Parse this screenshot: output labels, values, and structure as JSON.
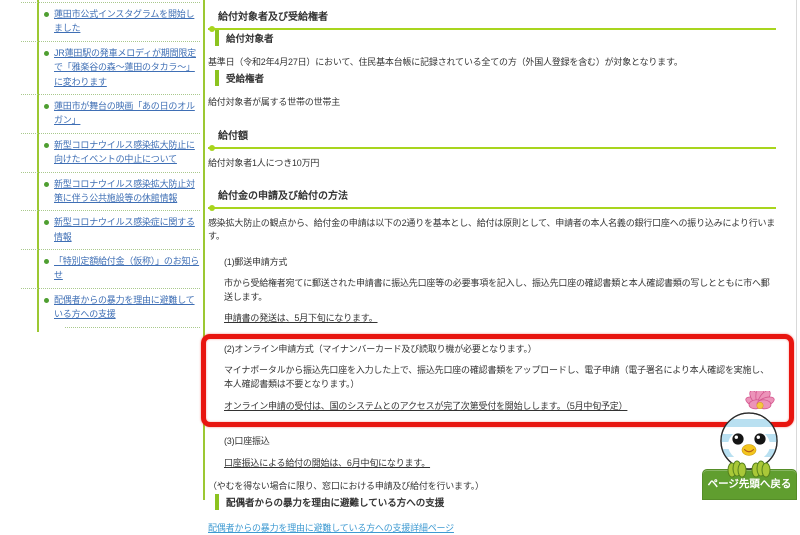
{
  "colors": {
    "accent_green_line": "#a8d51e",
    "accent_green_bar": "#8cc320",
    "sidebar_green_line": "#9cc832",
    "bullet_green": "#4f9f31",
    "link_blue": "#3f6fb5",
    "detail_link_blue": "#3e9ad2",
    "highlight_red": "#e8150f",
    "button_green": "#609e2f",
    "text": "#333333"
  },
  "sidebar": {
    "items": [
      {
        "label": "蓮田市公式インスタグラムを開始しました"
      },
      {
        "label": "JR蓮田駅の発車メロディが期間限定で「雅楽谷の森～蓮田のタカラ～」に変わります"
      },
      {
        "label": "蓮田市が舞台の映画「あの日のオルガン」"
      },
      {
        "label": "新型コロナウイルス感染拡大防止に向けたイベントの中止について"
      },
      {
        "label": "新型コロナウイルス感染拡大防止対策に伴う公共施設等の休館情報"
      },
      {
        "label": "新型コロナウイルス感染症に関する情報"
      },
      {
        "label": "「特別定額給付金（仮称）」のお知らせ"
      },
      {
        "label": "配偶者からの暴力を理由に避難している方への支援"
      }
    ]
  },
  "content": {
    "section1": {
      "h2": "給付対象者及び受給権者",
      "h3a": "給付対象者",
      "p1": "基準日（令和2年4月27日）において、住民基本台帳に記録されている全ての方（外国人登録を含む）が対象となります。",
      "h3b": "受給権者",
      "p2": "給付対象者が属する世帯の世帯主"
    },
    "section2": {
      "h2": "給付額",
      "p1": "給付対象者1人につき10万円"
    },
    "section3": {
      "h2": "給付金の申請及び給付の方法",
      "intro": "感染拡大防止の観点から、給付金の申請は以下の2通りを基本とし、給付は原則として、申請者の本人名義の銀行口座への振り込みにより行います。",
      "m1_title": "(1)郵送申請方式",
      "m1_body": "市から受給権者宛てに郵送された申請書に振込先口座等の必要事項を記入し、振込先口座の確認書類と本人確認書類の写しとともに市へ郵送します。",
      "m1_note": "申請書の発送は、5月下旬になります。",
      "m2_title": "(2)オンライン申請方式（マイナンバーカード及び読取り機が必要となります。）",
      "m2_body": "マイナポータルから振込先口座を入力した上で、振込先口座の確認書類をアップロードし、電子申請（電子署名により本人確認を実施し、本人確認書類は不要となります。）",
      "m2_note": "オンライン申請の受付は、国のシステムとのアクセスが完了次第受付を開始しします。（5月中旬予定）",
      "m3_title": "(3)口座振込",
      "m3_note": "口座振込による給付の開始は、6月中旬になります。",
      "outro": "（やむを得ない場合に限り、窓口における申請及び給付を行います。）"
    },
    "section4": {
      "h3": "配偶者からの暴力を理由に避難している方への支援",
      "link": "配偶者からの暴力を理由に避難している方への支援詳細ページ"
    }
  },
  "back_to_top": {
    "label": "ページ先頭へ戻る"
  }
}
